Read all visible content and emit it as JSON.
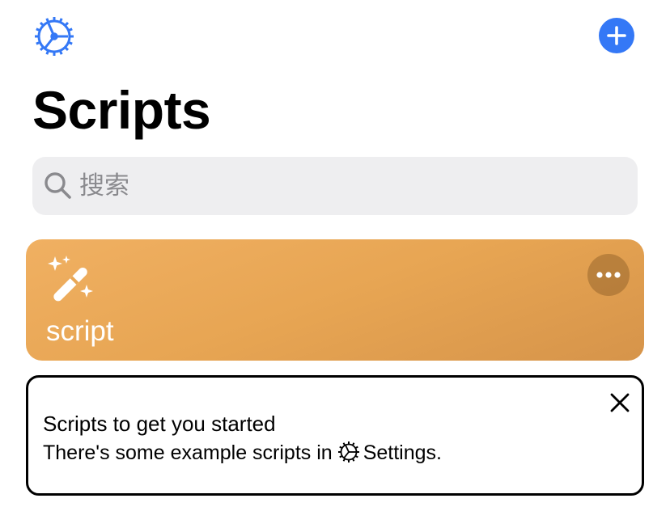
{
  "header": {
    "title": "Scripts",
    "settings_icon": "gear-icon",
    "add_icon": "plus-icon",
    "accent_color": "#3478f6"
  },
  "search": {
    "placeholder": "搜索",
    "value": ""
  },
  "scripts": [
    {
      "name": "script",
      "icon": "magic-wand-icon",
      "color": "#e9a857",
      "menu_icon": "ellipsis-icon"
    }
  ],
  "tip": {
    "title": "Scripts to get you started",
    "body_prefix": "There's some example scripts in",
    "body_link": "Settings.",
    "close_icon": "close-icon"
  }
}
